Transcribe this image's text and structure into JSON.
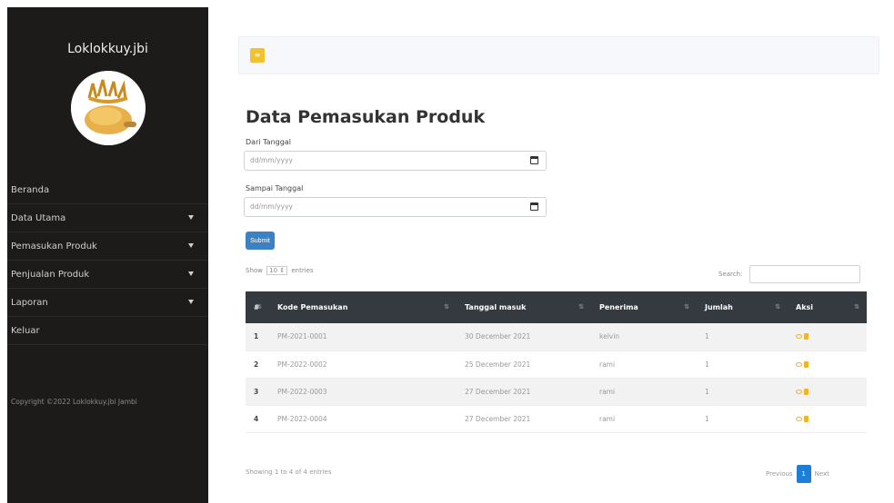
{
  "sidebar": {
    "brand": "Loklokkuy.jbi",
    "items": [
      {
        "label": "Beranda",
        "has_caret": false
      },
      {
        "label": "Data Utama",
        "has_caret": true
      },
      {
        "label": "Pemasukan Produk",
        "has_caret": true
      },
      {
        "label": "Penjualan Produk",
        "has_caret": true
      },
      {
        "label": "Laporan",
        "has_caret": true
      },
      {
        "label": "Keluar",
        "has_caret": false
      }
    ],
    "copyright": "Copyright ©2022 Loklokkuy.jbi Jambi"
  },
  "topbar": {
    "toggle_icon": "≡"
  },
  "main": {
    "title": "Data Pemasukan Produk",
    "from_label": "Dari Tanggal",
    "to_label": "Sampai Tanggal",
    "date_placeholder": "dd/mm/yyyy",
    "submit_label": "Submit",
    "length_prefix": "Show",
    "length_value": "10",
    "length_suffix": "entries",
    "search_label": "Search:",
    "columns": [
      "#",
      "Kode Pemasukan",
      "Tanggal masuk",
      "Penerima",
      "Jumlah",
      "Aksi"
    ],
    "rows": [
      {
        "no": "1",
        "kode": "PM-2021-0001",
        "tanggal": "30 December 2021",
        "penerima": "kelvin",
        "jumlah": "1"
      },
      {
        "no": "2",
        "kode": "PM-2022-0002",
        "tanggal": "25 December 2021",
        "penerima": "rami",
        "jumlah": "1"
      },
      {
        "no": "3",
        "kode": "PM-2022-0003",
        "tanggal": "27 December 2021",
        "penerima": "rami",
        "jumlah": "1"
      },
      {
        "no": "4",
        "kode": "PM-2022-0004",
        "tanggal": "27 December 2021",
        "penerima": "rami",
        "jumlah": "1"
      }
    ],
    "info": "Showing 1 to 4 of 4 entries",
    "pager": {
      "previous": "Previous",
      "current": "1",
      "next": "Next"
    }
  },
  "colors": {
    "sidebar_bg": "#1d1b1a",
    "accent_yellow": "#f2c12e",
    "primary_blue": "#3b82c4",
    "table_head": "#343a40"
  }
}
